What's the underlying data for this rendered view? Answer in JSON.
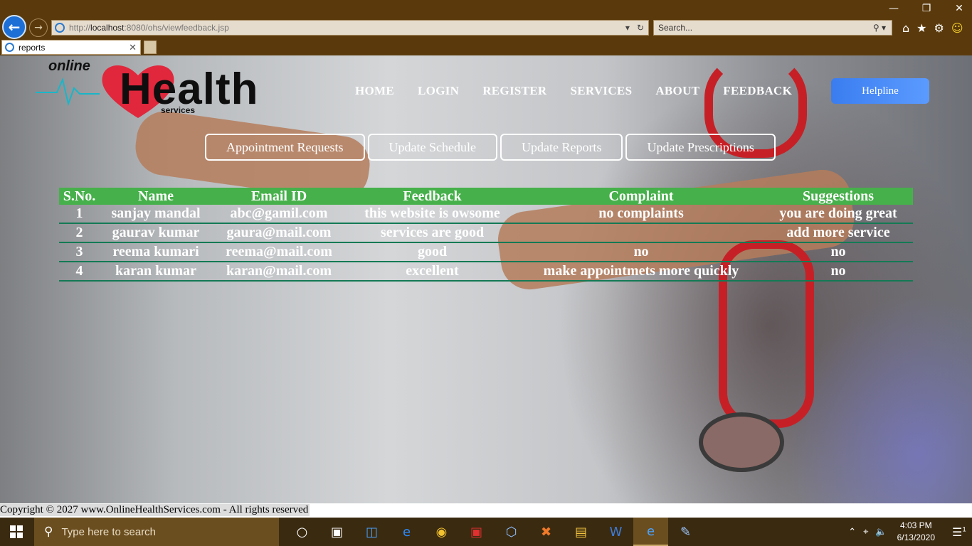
{
  "browser": {
    "url_prefix": "http://",
    "url_host": "localhost",
    "url_path": ":8080/ohs/viewfeedback.jsp",
    "search_placeholder": "Search...",
    "tab_title": "reports",
    "icons": [
      "home-icon",
      "star-icon",
      "gear-icon",
      "smiley-icon"
    ]
  },
  "logo": {
    "online": "online",
    "health": "Health",
    "services": "services"
  },
  "nav": {
    "home": "HOME",
    "login": "LOGIN",
    "register": "REGISTER",
    "services": "SERVICES",
    "about": "ABOUT",
    "feedback": "FEEDBACK",
    "helpline": "Helpline"
  },
  "subnav": {
    "appointment_requests": "Appointment Requests",
    "update_schedule": "Update Schedule",
    "update_reports": "Update Reports",
    "update_prescriptions": "Update Prescriptions"
  },
  "table": {
    "headers": [
      "S.No.",
      "Name",
      "Email ID",
      "Feedback",
      "Complaint",
      "Suggestions"
    ],
    "rows": [
      [
        "1",
        "sanjay mandal",
        "abc@gamil.com",
        "this website is owsome",
        "no complaints",
        "you are doing great"
      ],
      [
        "2",
        "gaurav kumar",
        "gaura@mail.com",
        "services are good",
        "",
        "add more service"
      ],
      [
        "3",
        "reema kumari",
        "reema@mail.com",
        "good",
        "no",
        "no"
      ],
      [
        "4",
        "karan kumar",
        "karan@mail.com",
        "excellent",
        "make appointmets more quickly",
        "no"
      ]
    ]
  },
  "footer": {
    "copyright": "Copyright © 2027 www.OnlineHealthServices.com - All rights reserved"
  },
  "taskbar": {
    "search_placeholder": "Type here to search",
    "time": "4:03 PM",
    "date": "6/13/2020",
    "notification_count": "1"
  },
  "colors": {
    "table_header_bg": "#46b04a",
    "row_divider": "#137a55",
    "helpline_bg": "#3a7df0",
    "chrome_bg": "#5a3a0c"
  }
}
